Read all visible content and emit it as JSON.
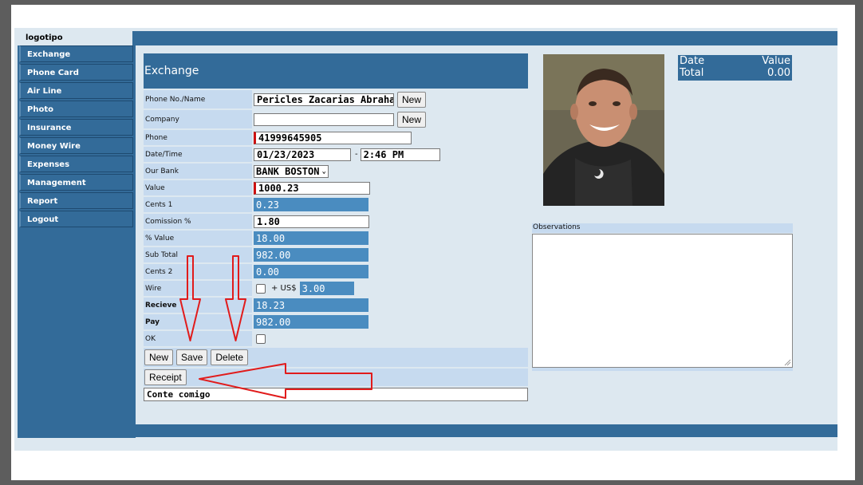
{
  "logo": "logotipo",
  "nav": [
    "Exchange",
    "Phone Card",
    "Air Line",
    "Photo",
    "Insurance",
    "Money Wire",
    "Expenses",
    "Management",
    "Report",
    "Logout"
  ],
  "form": {
    "title": "Exchange",
    "phone_name_label": "Phone No./Name",
    "phone_name_value": "Pericles Zacarias Abrahao",
    "new_label": "New",
    "company_label": "Company",
    "company_value": "",
    "phone_label": "Phone",
    "phone_value": "41999645905",
    "datetime_label": "Date/Time",
    "date_value": "01/23/2023",
    "time_sep": "-",
    "time_value": "2:46 PM",
    "bank_label": "Our Bank",
    "bank_value": "BANK BOSTON",
    "value_label": "Value",
    "value_value": "1000.23",
    "cents1_label": "Cents 1",
    "cents1_value": "0.23",
    "comission_label": "Comission %",
    "comission_value": "1.80",
    "pct_value_label": "% Value",
    "pct_value_value": "18.00",
    "subtotal_label": "Sub Total",
    "subtotal_value": "982.00",
    "cents2_label": "Cents 2",
    "cents2_value": "0.00",
    "wire_label": "Wire",
    "wire_plus": "+ US$",
    "wire_value": "3.00",
    "recieve_label": "Recieve",
    "recieve_value": "18.23",
    "pay_label": "Pay",
    "pay_value": "982.00",
    "ok_label": "OK",
    "save_label": "Save",
    "delete_label": "Delete",
    "receipt_label": "Receipt",
    "note_value": "Conte comigo"
  },
  "totals": {
    "date_header": "Date",
    "value_header": "Value",
    "total_label": "Total",
    "total_value": "0.00"
  },
  "observations_label": "Observations",
  "colors": {
    "header_blue": "#336b99",
    "panel_light": "#dde8f0",
    "label_bg": "#c6daef",
    "readonly_blue": "#4a8cc0",
    "annotation_red": "#e11b1b"
  }
}
